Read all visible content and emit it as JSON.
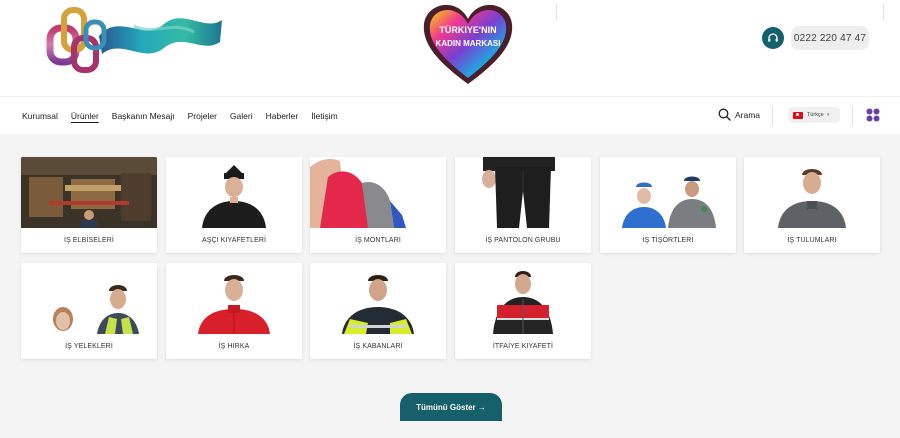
{
  "header": {
    "phone_number": "0222 220 47 47",
    "heart_logo_lines": [
      "TÜRKIYE'NIN",
      "KADIN MARKASI"
    ]
  },
  "nav": {
    "items": [
      "Kurumsal",
      "Ürünler",
      "Başkanın Mesajı",
      "Projeler",
      "Galeri",
      "Haberler",
      "İletişim"
    ],
    "active_index": 1,
    "search_label": "Arama",
    "language_label": "Türkçe"
  },
  "products": {
    "row1": [
      "İŞ ELBİSELERİ",
      "AŞÇI KIYAFETLERİ",
      "İŞ MONTLARI",
      "İŞ PANTOLON GRUBU",
      "İŞ TİŞÖRTLERİ",
      "İŞ TULUMLARI"
    ],
    "row2": [
      "İŞ YELEKLERİ",
      "İŞ HIRKA",
      "İŞ KABANLARI",
      "İTFAİYE KIYAFETİ"
    ]
  },
  "show_all_label": "Tümünü Göster →",
  "colors": {
    "accent": "#15606a",
    "page_bg": "#f4f4f4"
  }
}
